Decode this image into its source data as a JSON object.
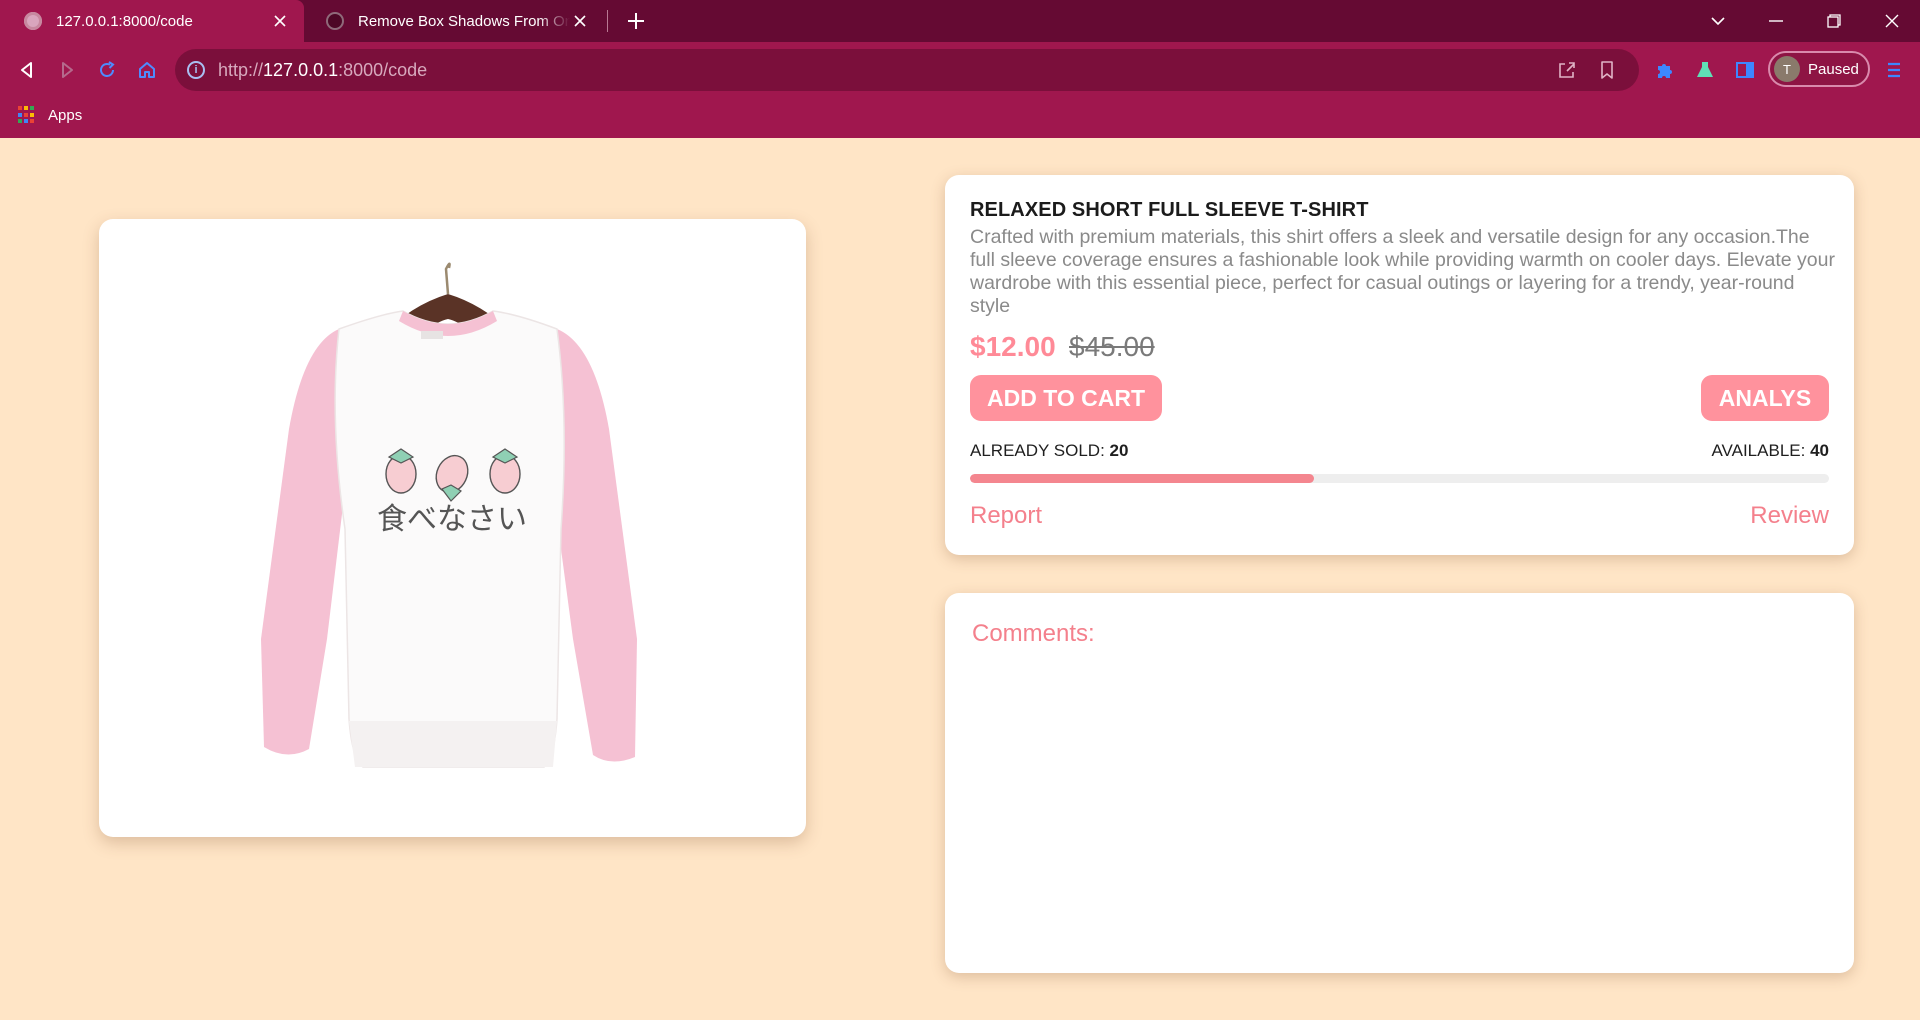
{
  "browser": {
    "tabs": [
      {
        "title": "127.0.0.1:8000/code",
        "active": true
      },
      {
        "title": "Remove Box Shadows From One",
        "active": false
      }
    ],
    "url_prefix": "http://",
    "url_host": "127.0.0.1",
    "url_rest": ":8000/code",
    "profile_initial": "T",
    "profile_status": "Paused",
    "bookmarks": [
      {
        "label": "Apps",
        "icon": "apps-grid-icon"
      }
    ],
    "colors": {
      "tabstrip": "#650a33",
      "toolbar": "#a0174e",
      "omnibox": "#7b0f3b"
    }
  },
  "product": {
    "image_alt": "Pink and white raglan sweatshirt with strawberries on a hanger",
    "print_text": "食べなさい",
    "title": "RELAXED SHORT FULL SLEEVE T-SHIRT",
    "description": "Crafted with premium materials, this shirt offers a sleek and versatile design for any occasion.The full sleeve coverage ensures a fashionable look while providing warmth on cooler days. Elevate your wardrobe with this essential piece, perfect for casual outings or layering for a trendy, year-round style",
    "price": "$12.00",
    "old_price": "$45.00",
    "add_to_cart_label": "ADD TO CART",
    "analys_label": "ANALYS",
    "sold_label": "ALREADY SOLD:",
    "sold_value": "20",
    "available_label": "AVAILABLE:",
    "available_value": "40",
    "progress_fraction": 0.4,
    "report_label": "Report",
    "review_label": "Review"
  },
  "comments": {
    "title": "Comments:"
  },
  "colors": {
    "page_bg": "#ffe5c6",
    "accent": "#ff929d",
    "link": "#f4808c"
  }
}
